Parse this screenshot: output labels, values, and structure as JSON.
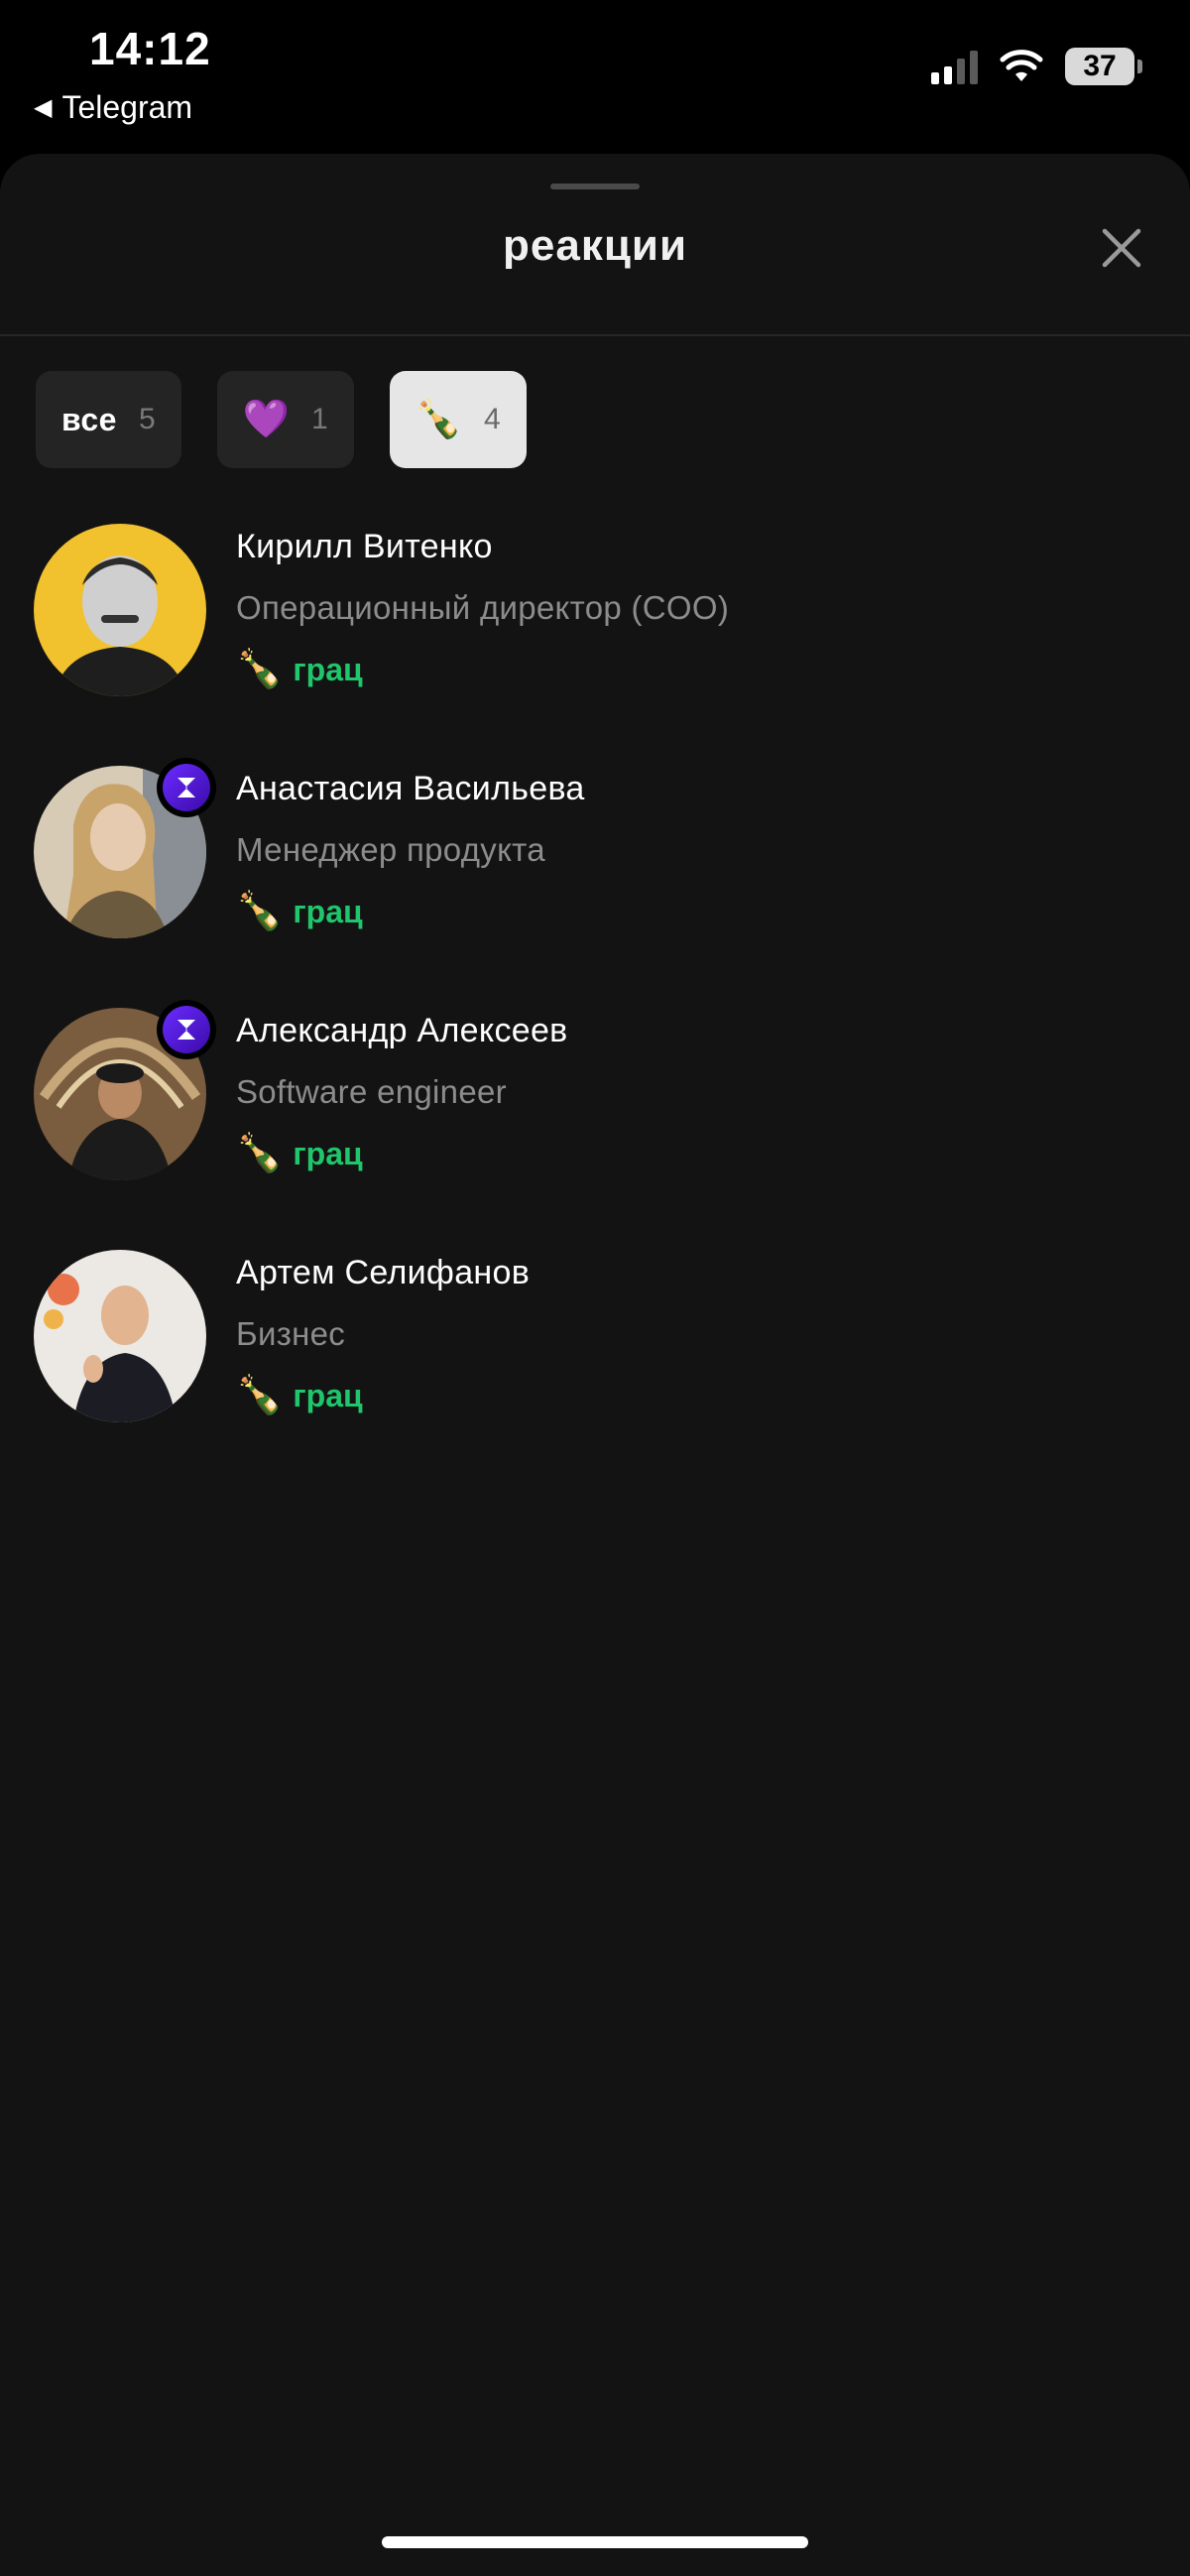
{
  "status_bar": {
    "time": "14:12",
    "back_app": "Telegram",
    "battery": "37"
  },
  "sheet": {
    "title": "реакции",
    "close_icon": "close-icon"
  },
  "tabs": [
    {
      "label": "все",
      "count": "5",
      "active": false
    },
    {
      "emoji": "💜",
      "count": "1",
      "active": false
    },
    {
      "emoji": "🍾",
      "count": "4",
      "active": true
    }
  ],
  "reactions": [
    {
      "name": "Кирилл Витенко",
      "role": "Операционный директор (COO)",
      "emoji": "🍾",
      "reaction": "грац",
      "badge": false,
      "avatar_color": "#f2c12e"
    },
    {
      "name": "Анастасия Васильева",
      "role": "Менеджер продукта",
      "emoji": "🍾",
      "reaction": "грац",
      "badge": true,
      "avatar_color": "#c9b08c"
    },
    {
      "name": "Александр Алексеев",
      "role": "Software engineer",
      "emoji": "🍾",
      "reaction": "грац",
      "badge": true,
      "avatar_color": "#8c6a4a"
    },
    {
      "name": "Артем Селифанов",
      "role": "Бизнес",
      "emoji": "🍾",
      "reaction": "грац",
      "badge": false,
      "avatar_color": "#e8e4e0"
    }
  ],
  "colors": {
    "accent_green": "#1fc66b",
    "sheet_bg": "#131313",
    "badge_purple": "#6a2cff"
  }
}
